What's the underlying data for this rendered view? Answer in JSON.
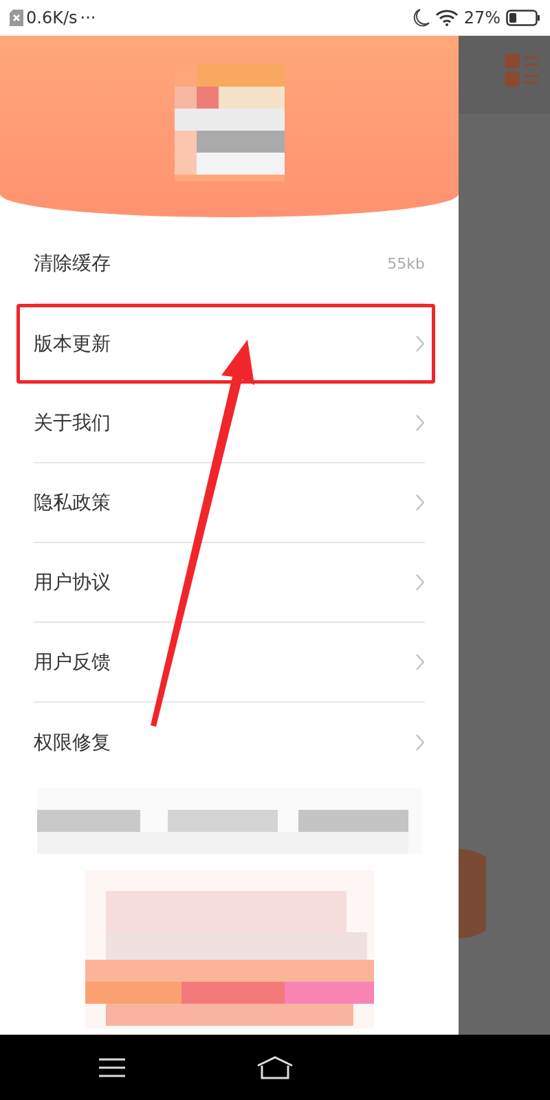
{
  "status_bar": {
    "network_speed": "0.6K/s",
    "more": "···",
    "battery": "27%"
  },
  "menu": [
    {
      "kind": "value",
      "label": "清除缓存",
      "value": "55kb",
      "highlighted": false
    },
    {
      "kind": "link",
      "label": "版本更新",
      "highlighted": true
    },
    {
      "kind": "link",
      "label": "关于我们",
      "highlighted": false
    },
    {
      "kind": "link",
      "label": "隐私政策",
      "highlighted": false
    },
    {
      "kind": "link",
      "label": "用户协议",
      "highlighted": false
    },
    {
      "kind": "link",
      "label": "用户反馈",
      "highlighted": false
    },
    {
      "kind": "link",
      "label": "权限修复",
      "highlighted": false
    }
  ]
}
